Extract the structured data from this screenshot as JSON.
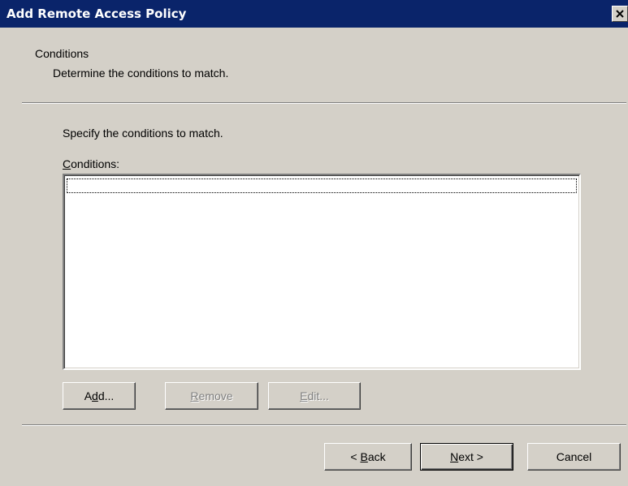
{
  "window": {
    "title": "Add Remote Access Policy",
    "close_icon": "close-icon"
  },
  "header": {
    "title": "Conditions",
    "subtitle": "Determine the conditions to match."
  },
  "body": {
    "prompt": "Specify the conditions to match.",
    "conditions_label_accel": "C",
    "conditions_label_rest": "onditions:",
    "conditions_items": []
  },
  "list_buttons": {
    "add": {
      "pre": "A",
      "accel": "d",
      "post": "d..."
    },
    "remove": {
      "accel": "R",
      "post": "emove"
    },
    "edit": {
      "accel": "E",
      "post": "dit..."
    }
  },
  "nav_buttons": {
    "back": {
      "pre": "< ",
      "accel": "B",
      "post": "ack"
    },
    "next": {
      "accel": "N",
      "post": "ext >"
    },
    "cancel": "Cancel"
  }
}
